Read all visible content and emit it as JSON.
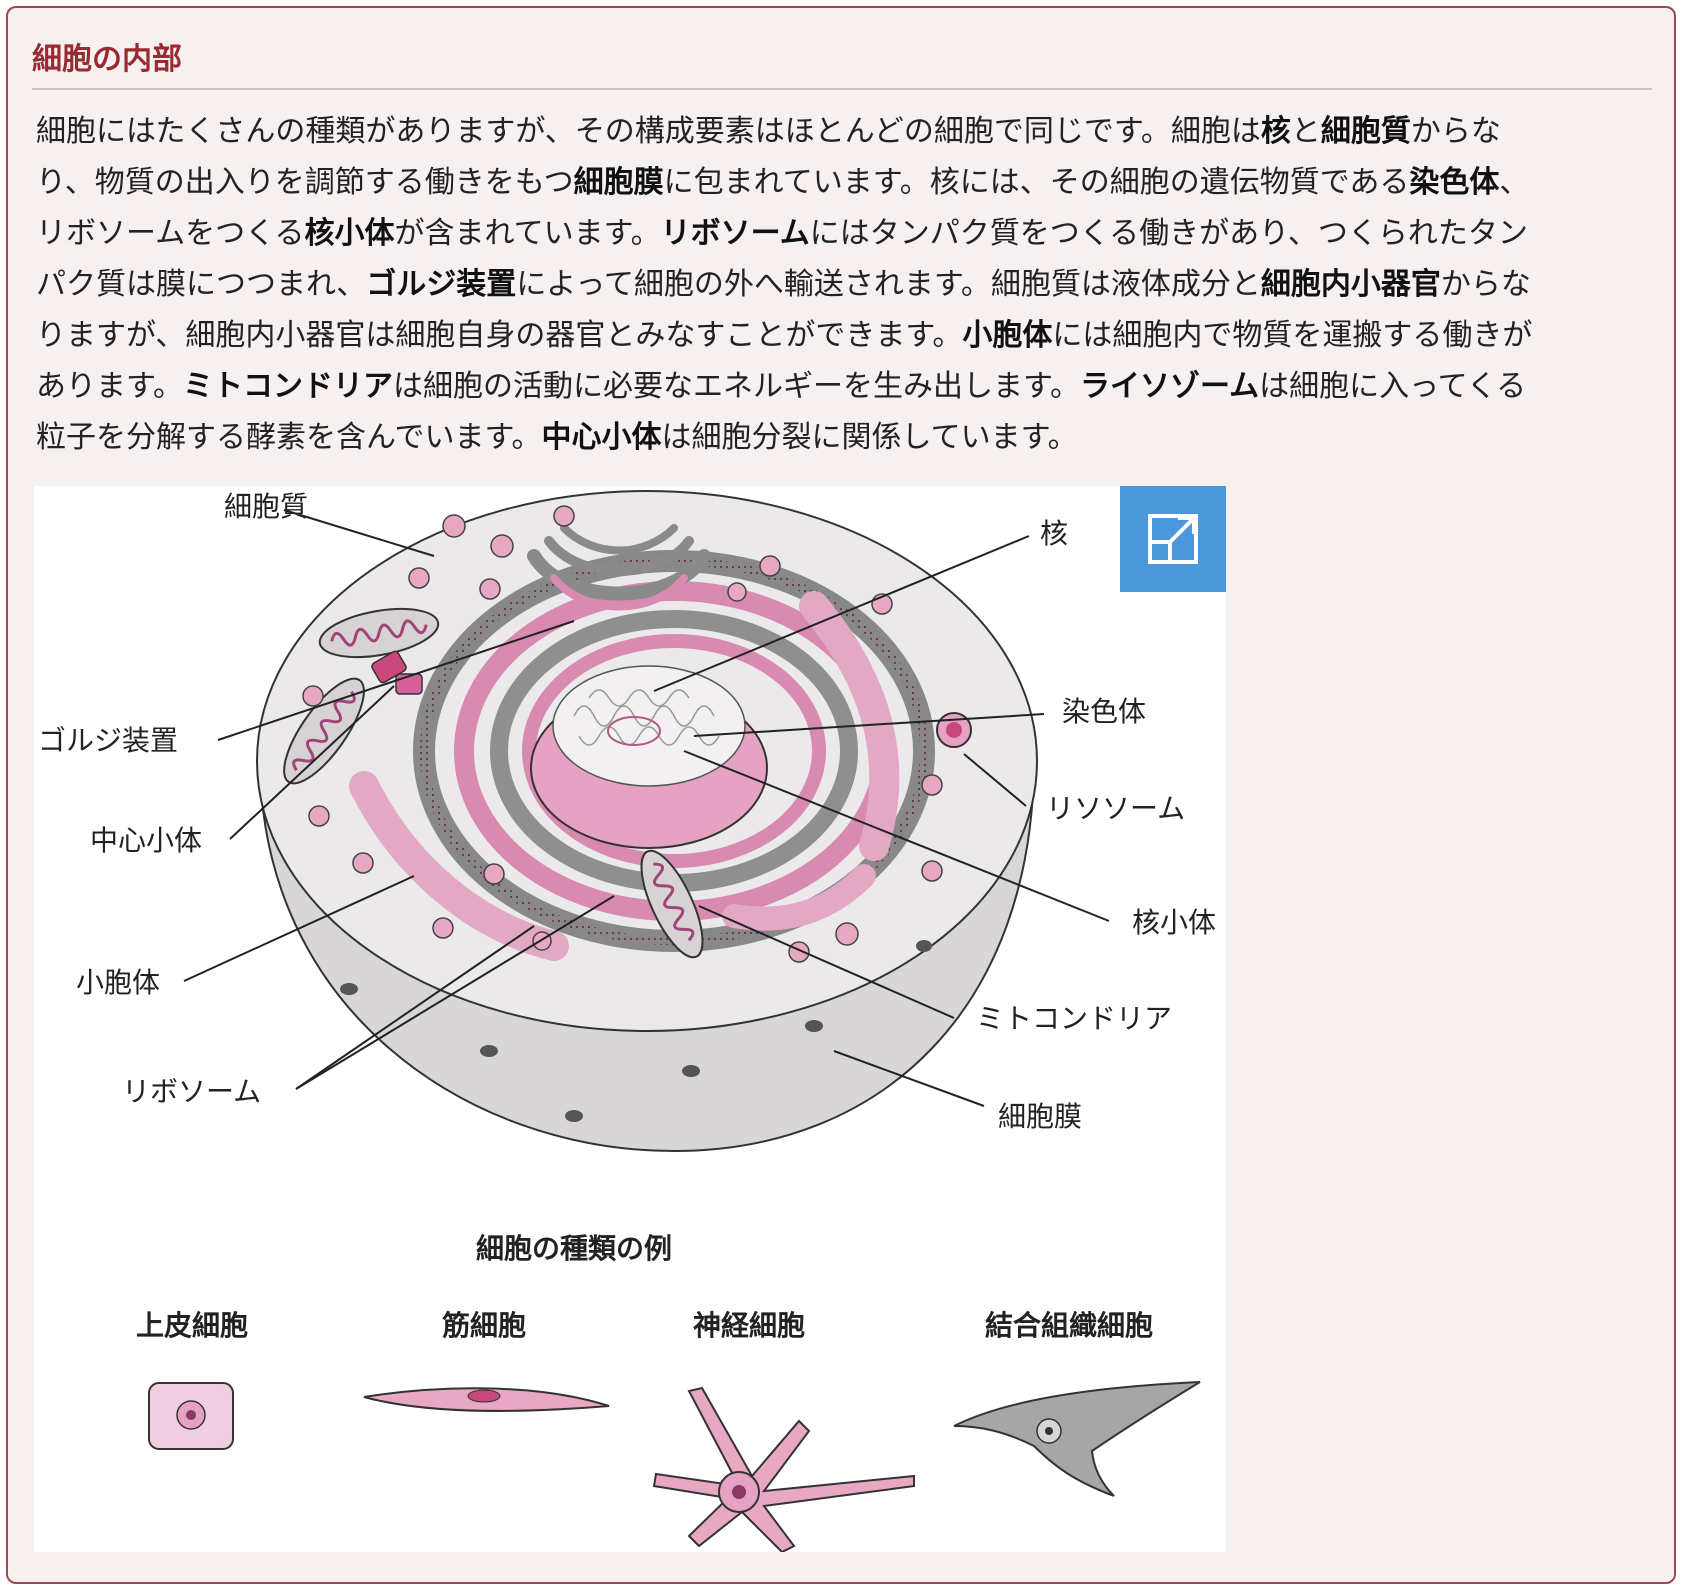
{
  "section": {
    "title": "細胞の内部"
  },
  "body_lines": [
    [
      {
        "t": "細胞にはたくさんの種類がありますが、その構成要素はほとんどの細胞で同じです。細胞は"
      },
      {
        "b": "核"
      },
      {
        "t": "と"
      },
      {
        "b": "細胞質"
      },
      {
        "t": "からな"
      }
    ],
    [
      {
        "t": "り、物質の出入りを調節する働きをもつ"
      },
      {
        "b": "細胞膜"
      },
      {
        "t": "に包まれています。核には、その細胞の遺伝物質である"
      },
      {
        "b": "染色体"
      },
      {
        "t": "、"
      }
    ],
    [
      {
        "t": "リボソームをつくる"
      },
      {
        "b": "核小体"
      },
      {
        "t": "が含まれています。"
      },
      {
        "b": "リボソーム"
      },
      {
        "t": "にはタンパク質をつくる働きがあり、つくられたタン"
      }
    ],
    [
      {
        "t": "パク質は膜につつまれ、"
      },
      {
        "b": "ゴルジ装置"
      },
      {
        "t": "によって細胞の外へ輸送されます。細胞質は液体成分と"
      },
      {
        "b": "細胞内小器官"
      },
      {
        "t": "からな"
      }
    ],
    [
      {
        "t": "りますが、細胞内小器官は細胞自身の器官とみなすことができます。"
      },
      {
        "b": "小胞体"
      },
      {
        "t": "には細胞内で物質を運搬する働きが"
      }
    ],
    [
      {
        "t": "あります。"
      },
      {
        "b": "ミトコンドリア"
      },
      {
        "t": "は細胞の活動に必要なエネルギーを生み出します。"
      },
      {
        "b": "ライソゾーム"
      },
      {
        "t": "は細胞に入ってくる"
      }
    ],
    [
      {
        "t": "粒子を分解する酵素を含んでいます。"
      },
      {
        "b": "中心小体"
      },
      {
        "t": "は細胞分裂に関係しています。"
      }
    ]
  ],
  "figure": {
    "labels": {
      "cytoplasm": "細胞質",
      "golgi": "ゴルジ装置",
      "centriole": "中心小体",
      "er": "小胞体",
      "ribosome": "リボソーム",
      "nucleus": "核",
      "chromosome": "染色体",
      "lysosome": "リソソーム",
      "nucleolus": "核小体",
      "mitochondria": "ミトコンドリア",
      "membrane": "細胞膜"
    },
    "types_title": "細胞の種類の例",
    "types": {
      "epithelial": "上皮細胞",
      "muscle": "筋細胞",
      "nerve": "神経細胞",
      "connective": "結合組織細胞"
    },
    "expand_icon": "expand-icon",
    "colors": {
      "pink": "#e8a8c4",
      "magenta": "#c8487e",
      "gray": "#9a9a9a",
      "expand_bg": "#4b97d9",
      "title": "#9a2a30"
    }
  }
}
